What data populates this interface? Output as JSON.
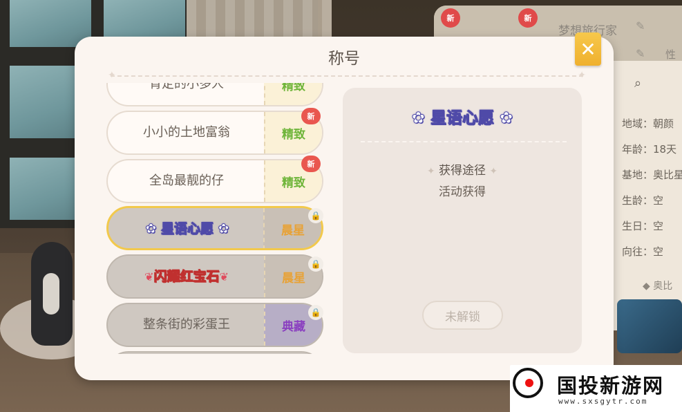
{
  "profile": {
    "new_badge": "新",
    "name": "梦想旅行家",
    "gender": "性",
    "stats": [
      "地域：朝颜",
      "年龄：18天",
      "基地：奥比星",
      "生龄：空",
      "生日：空",
      "向往：空"
    ],
    "more": "◆ 奥比"
  },
  "modal": {
    "title": "称号",
    "close_icon": "✕"
  },
  "titles": [
    {
      "name": "肯定的小多人",
      "tier": "精致",
      "tier_style": "jingzhi",
      "new": false,
      "locked": false
    },
    {
      "name": "小小的土地富翁",
      "tier": "精致",
      "tier_style": "jingzhi",
      "new": true,
      "locked": false
    },
    {
      "name": "全岛最靓的仔",
      "tier": "精致",
      "tier_style": "jingzhi",
      "new": true,
      "locked": false
    },
    {
      "name": "星语心愿",
      "tier": "晨星",
      "tier_style": "chenxing",
      "new": false,
      "locked": true
    },
    {
      "name": "闪耀红宝石",
      "tier": "晨星",
      "tier_style": "chenxing",
      "new": false,
      "locked": true
    },
    {
      "name": "整条街的彩蛋王",
      "tier": "典藏",
      "tier_style": "diancang",
      "new": false,
      "locked": true
    }
  ],
  "new_tag": "新",
  "detail": {
    "title": "星语心愿",
    "obtain_label": "获得途径",
    "obtain_source": "活动获得",
    "unlock_button": "未解锁"
  },
  "watermark": {
    "text": "国投新游网",
    "url": "www.sxsgytr.com"
  }
}
